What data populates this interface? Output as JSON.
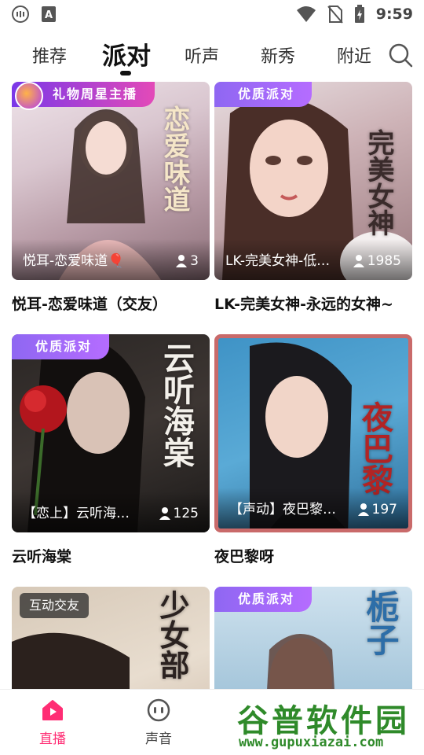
{
  "status_bar": {
    "time": "9:59",
    "icons": [
      "chat-bubble-icon",
      "a-badge-icon",
      "wifi-icon",
      "no-sim-icon",
      "battery-charging-icon"
    ]
  },
  "top_nav": {
    "tabs": [
      {
        "label": "推荐"
      },
      {
        "label": "派对",
        "active": true
      },
      {
        "label": "听声"
      },
      {
        "label": "新秀"
      },
      {
        "label": "附近"
      }
    ],
    "search_icon": "search-icon"
  },
  "rooms": [
    {
      "badge": "礼物周星主播",
      "badge_type": "gift",
      "cover_title": "悦耳-恋爱味道🎈",
      "count": "3",
      "name": "悦耳-恋爱味道（交友）",
      "art_text": "恋爱味道"
    },
    {
      "badge": "优质派对",
      "badge_type": "quality",
      "cover_title": "LK-完美女神-低…",
      "count": "1985",
      "name": "LK-完美女神-永远的女神~",
      "art_text": "完美女神"
    },
    {
      "badge": "优质派对",
      "badge_type": "quality",
      "cover_title": "【恋上】云听海…",
      "count": "125",
      "name": "云听海棠",
      "art_text": "云听海棠"
    },
    {
      "badge": "",
      "badge_type": "none",
      "cover_title": "【声动】夜巴黎…",
      "count": "197",
      "name": "夜巴黎呀",
      "art_text": "夜巴黎"
    },
    {
      "badge": "互动交友",
      "badge_type": "interact",
      "cover_title": "",
      "count": "",
      "name": "",
      "art_text": "少女部"
    },
    {
      "badge": "优质派对",
      "badge_type": "quality",
      "cover_title": "",
      "count": "",
      "name": "",
      "art_text": "栀子"
    }
  ],
  "bottom_nav": {
    "items": [
      {
        "label": "直播",
        "icon": "live-home-icon",
        "active": true
      },
      {
        "label": "声音",
        "icon": "voice-icon"
      }
    ]
  },
  "watermark": {
    "main": "谷普软件园",
    "sub": "www.gupuxiazai.com"
  },
  "colors": {
    "accent": "#ff2d74",
    "badge_quality": "#9b6cf5",
    "badge_gift": "#c340d0"
  }
}
